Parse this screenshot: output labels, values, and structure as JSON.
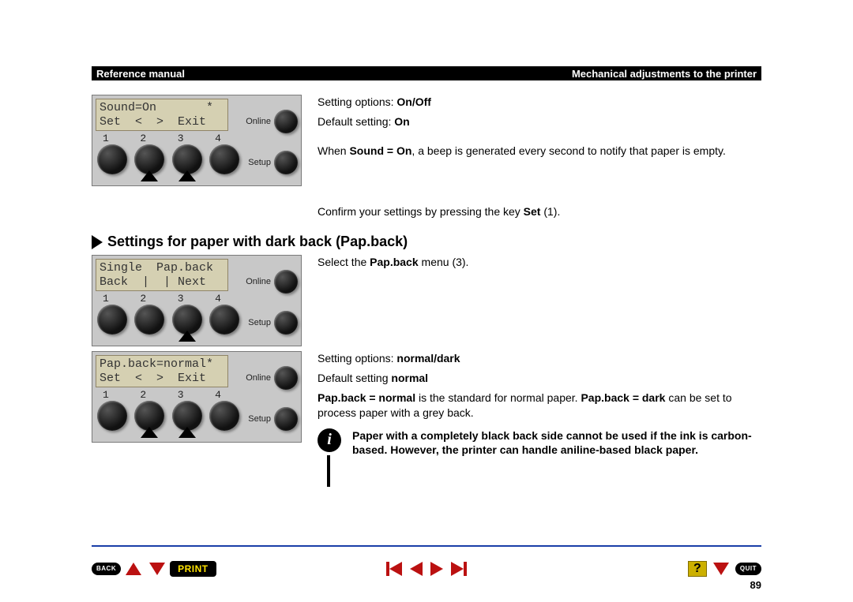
{
  "header": {
    "left": "Reference manual",
    "right": "Mechanical adjustments to the printer"
  },
  "section1": {
    "display_line1": "Sound=On       *",
    "display_line2": "Set  <  >  Exit",
    "nums": [
      "1",
      "2",
      "3",
      "4"
    ],
    "online": "Online",
    "setup": "Setup",
    "text": {
      "opts_label": "Setting options:  ",
      "opts_val": "On/Off",
      "def_label": "Default setting:  ",
      "def_val": "On",
      "desc_a": "When ",
      "desc_b": "Sound = On",
      "desc_c": ", a beep is generated every second to notify that paper is empty."
    },
    "confirm_a": "Confirm your settings by pressing the key ",
    "confirm_b": "Set",
    "confirm_c": " (1)."
  },
  "section_heading": "Settings for paper with dark back (Pap.back)",
  "section2": {
    "display_line1": "Single  Pap.back",
    "display_line2": "Back  |  | Next",
    "nums": [
      "1",
      "2",
      "3",
      "4"
    ],
    "online": "Online",
    "setup": "Setup",
    "text_a": "Select the ",
    "text_b": "Pap.back",
    "text_c": " menu (3)."
  },
  "section3": {
    "display_line1": "Pap.back=normal*",
    "display_line2": "Set  <  >  Exit",
    "nums": [
      "1",
      "2",
      "3",
      "4"
    ],
    "online": "Online",
    "setup": "Setup",
    "text": {
      "opts_label": "Setting options:  ",
      "opts_val": "normal/dark",
      "def_label": "Default setting    ",
      "def_val": "normal",
      "p1_a": "Pap.back = normal",
      "p1_b": " is the standard for normal paper. ",
      "p1_c": "Pap.back = dark",
      "p1_d": " can be set to process paper with a grey back."
    },
    "info": "Paper with a completely black back side cannot be used if the ink is carbon-based. However, the printer can handle aniline-based black paper."
  },
  "nav": {
    "back": "BACK",
    "print": "PRINT",
    "quit": "QUIT",
    "help": "?"
  },
  "page_number": "89"
}
